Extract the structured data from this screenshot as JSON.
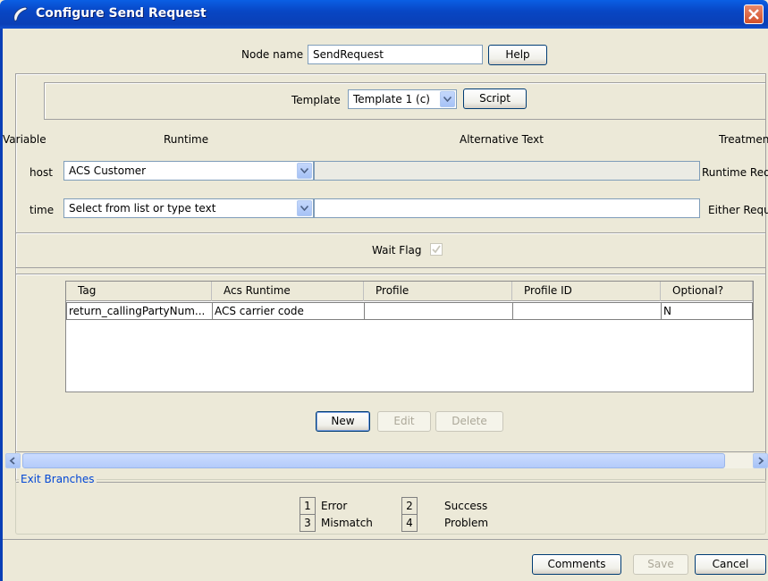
{
  "window": {
    "title": "Configure Send Request"
  },
  "node": {
    "label": "Node name",
    "value": "SendRequest",
    "help_label": "Help"
  },
  "template": {
    "label": "Template",
    "selected": "Template 1 (c)",
    "script_label": "Script"
  },
  "variables": {
    "headers": [
      "Variable",
      "Runtime",
      "Alternative Text",
      "Treatmen"
    ],
    "rows": [
      {
        "variable": "host",
        "runtime": "ACS Customer",
        "alt_text": "",
        "treatment": "Runtime Req"
      },
      {
        "variable": "time",
        "runtime": "Select from list or type text",
        "alt_text": "",
        "treatment": "Either Requ"
      }
    ]
  },
  "wait_flag": {
    "label": "Wait Flag",
    "checked": true
  },
  "table": {
    "columns": [
      "Tag",
      "Acs Runtime",
      "Profile",
      "Profile ID",
      "Optional?"
    ],
    "rows": [
      [
        "return_callingPartyNum...",
        "ACS carrier code",
        "",
        "",
        "N"
      ]
    ],
    "buttons": {
      "new": "New",
      "edit": "Edit",
      "delete": "Delete"
    }
  },
  "exit_branches": {
    "title": "Exit Branches",
    "items": [
      {
        "num": "1",
        "label": "Error"
      },
      {
        "num": "2",
        "label": "Success"
      },
      {
        "num": "3",
        "label": "Mismatch"
      },
      {
        "num": "4",
        "label": "Problem"
      }
    ]
  },
  "footer": {
    "comments": "Comments",
    "save": "Save",
    "cancel": "Cancel"
  },
  "colors": {
    "title_bar": "#0a46c4",
    "dialog_bg": "#ece9d8",
    "group_title": "#0046d5",
    "field_border": "#7f9db9"
  }
}
